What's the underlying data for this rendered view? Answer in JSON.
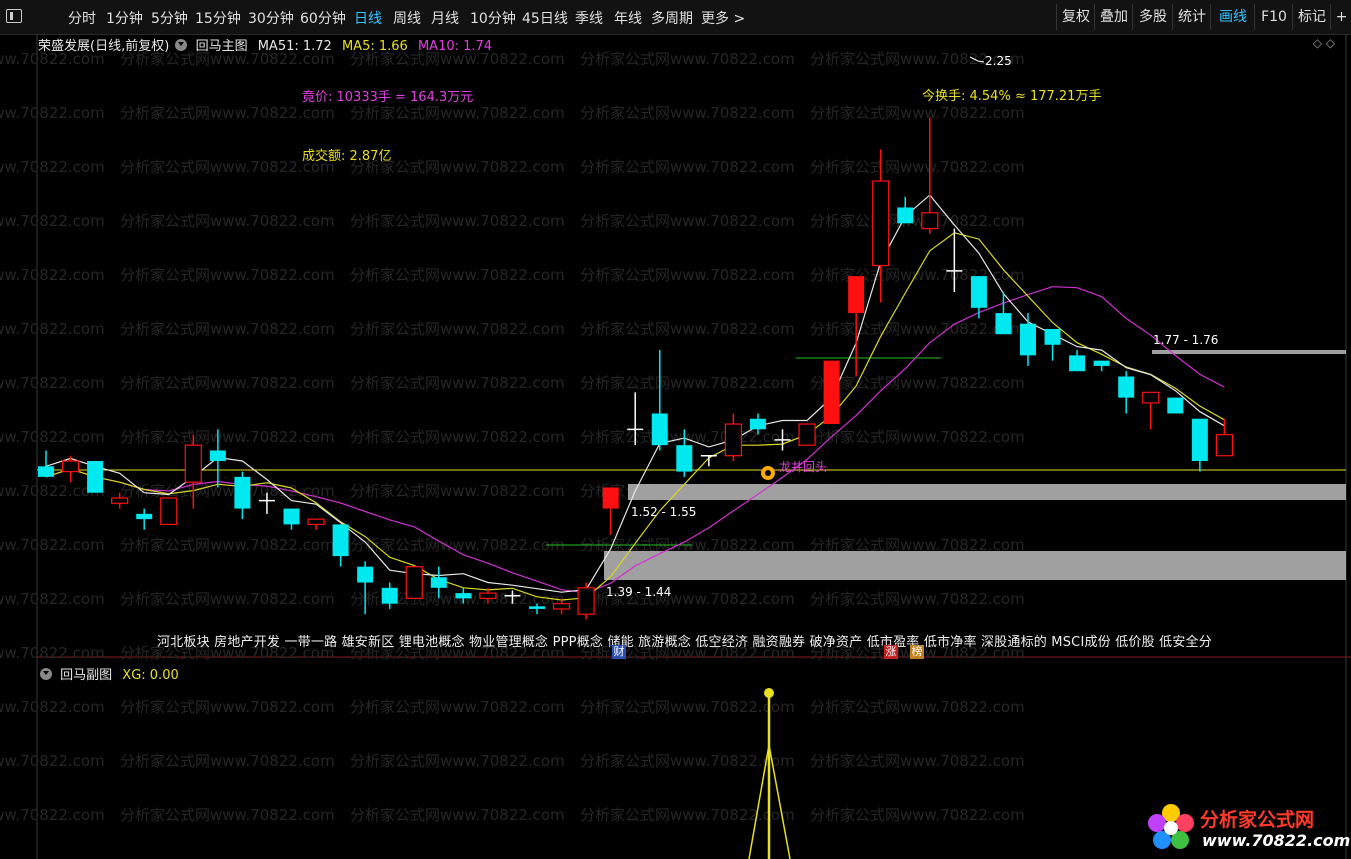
{
  "toolbar": {
    "periods": [
      "分时",
      "1分钟",
      "5分钟",
      "15分钟",
      "30分钟",
      "60分钟",
      "日线",
      "周线",
      "月线",
      "10分钟",
      "45日线",
      "季线",
      "年线",
      "多周期",
      "更多 >"
    ],
    "active_period": "日线",
    "right_buttons": [
      "复权",
      "叠加",
      "多股",
      "统计",
      "画线",
      "F10",
      "标记",
      "+"
    ],
    "active_right": "画线"
  },
  "main_chart": {
    "stock_name": "荣盛发展(日线,前复权)",
    "indicator": "回马主图",
    "ma51": "MA51: 1.72",
    "ma5": "MA5: 1.66",
    "ma10": "MA10: 1.74",
    "auction_label": "竟价: 10333手 = 164.3万元",
    "turnover_amount": "成交额: 2.87亿",
    "turnover_rate": "今换手: 4.54% ≈ 177.21万手",
    "high_marker": "2.25",
    "resist_label": "1.77 - 1.76",
    "support1_label": "1.52 - 1.55",
    "support2_label": "1.39 - 1.44",
    "signal_label": "龙井回头",
    "watermark": "分析家公式网www.70822.com"
  },
  "concepts": "河北板块 房地产开发 一带一路 雄安新区 锂电池概念 物业管理概念 PPP概念 储能 旅游概念 低空经济 融资融券 破净资产 低市盈率 低市净率 深股通标的 MSCI成份 低价股 低安全分",
  "badges": {
    "cai": "财",
    "zhang": "涨",
    "bang": "榜"
  },
  "sub_chart": {
    "indicator": "回马副图",
    "xg": "XG: 0.00"
  },
  "logo": {
    "name": "分析家公式网",
    "url": "www.70822.com"
  },
  "colors": {
    "up": "#ff1010",
    "down": "#00e8f0",
    "ma_white": "#e8e8e8",
    "ma_yellow": "#d8d820",
    "ma_magenta": "#d030d0",
    "label_magenta": "#e040e0",
    "label_yellow": "#e8e020",
    "gray_band": "#a0a0a0",
    "active": "#35c5ff"
  },
  "candles": [
    {
      "o": 1.59,
      "h": 1.62,
      "l": 1.57,
      "c": 1.57
    },
    {
      "o": 1.58,
      "h": 1.61,
      "l": 1.56,
      "c": 1.6
    },
    {
      "o": 1.6,
      "h": 1.6,
      "l": 1.54,
      "c": 1.54
    },
    {
      "o": 1.52,
      "h": 1.54,
      "l": 1.51,
      "c": 1.53
    },
    {
      "o": 1.5,
      "h": 1.51,
      "l": 1.47,
      "c": 1.49
    },
    {
      "o": 1.48,
      "h": 1.53,
      "l": 1.48,
      "c": 1.53
    },
    {
      "o": 1.56,
      "h": 1.65,
      "l": 1.51,
      "c": 1.63
    },
    {
      "o": 1.62,
      "h": 1.66,
      "l": 1.55,
      "c": 1.6
    },
    {
      "o": 1.57,
      "h": 1.58,
      "l": 1.49,
      "c": 1.51
    },
    {
      "o": 1.525,
      "h": 1.54,
      "l": 1.5,
      "c": 1.525
    },
    {
      "o": 1.51,
      "h": 1.51,
      "l": 1.47,
      "c": 1.48
    },
    {
      "o": 1.48,
      "h": 1.49,
      "l": 1.47,
      "c": 1.49
    },
    {
      "o": 1.48,
      "h": 1.48,
      "l": 1.4,
      "c": 1.42
    },
    {
      "o": 1.4,
      "h": 1.41,
      "l": 1.31,
      "c": 1.37
    },
    {
      "o": 1.36,
      "h": 1.37,
      "l": 1.32,
      "c": 1.33
    },
    {
      "o": 1.34,
      "h": 1.4,
      "l": 1.34,
      "c": 1.4
    },
    {
      "o": 1.38,
      "h": 1.4,
      "l": 1.34,
      "c": 1.36
    },
    {
      "o": 1.35,
      "h": 1.36,
      "l": 1.33,
      "c": 1.34
    },
    {
      "o": 1.34,
      "h": 1.36,
      "l": 1.33,
      "c": 1.35
    },
    {
      "o": 1.345,
      "h": 1.355,
      "l": 1.33,
      "c": 1.345
    },
    {
      "o": 1.325,
      "h": 1.33,
      "l": 1.31,
      "c": 1.32
    },
    {
      "o": 1.32,
      "h": 1.34,
      "l": 1.31,
      "c": 1.33
    },
    {
      "o": 1.31,
      "h": 1.37,
      "l": 1.3,
      "c": 1.36
    },
    {
      "o": 1.51,
      "h": 1.53,
      "l": 1.46,
      "c": 1.55
    },
    {
      "o": 1.66,
      "h": 1.73,
      "l": 1.63,
      "c": 1.66
    },
    {
      "o": 1.69,
      "h": 1.81,
      "l": 1.62,
      "c": 1.63
    },
    {
      "o": 1.63,
      "h": 1.66,
      "l": 1.57,
      "c": 1.58
    },
    {
      "o": 1.61,
      "h": 1.61,
      "l": 1.59,
      "c": 1.61
    },
    {
      "o": 1.61,
      "h": 1.69,
      "l": 1.6,
      "c": 1.67
    },
    {
      "o": 1.68,
      "h": 1.69,
      "l": 1.65,
      "c": 1.66
    },
    {
      "o": 1.64,
      "h": 1.66,
      "l": 1.62,
      "c": 1.64
    },
    {
      "o": 1.63,
      "h": 1.67,
      "l": 1.63,
      "c": 1.67
    },
    {
      "o": 1.67,
      "h": 1.79,
      "l": 1.67,
      "c": 1.79
    },
    {
      "o": 1.88,
      "h": 1.88,
      "l": 1.76,
      "c": 1.95
    },
    {
      "o": 1.97,
      "h": 2.19,
      "l": 1.9,
      "c": 2.13
    },
    {
      "o": 2.08,
      "h": 2.1,
      "l": 2.05,
      "c": 2.05
    },
    {
      "o": 2.04,
      "h": 2.25,
      "l": 2.03,
      "c": 2.07
    },
    {
      "o": 1.96,
      "h": 2.04,
      "l": 1.92,
      "c": 1.96
    },
    {
      "o": 1.95,
      "h": 1.95,
      "l": 1.87,
      "c": 1.89
    },
    {
      "o": 1.88,
      "h": 1.92,
      "l": 1.84,
      "c": 1.84
    },
    {
      "o": 1.86,
      "h": 1.88,
      "l": 1.78,
      "c": 1.8
    },
    {
      "o": 1.85,
      "h": 1.85,
      "l": 1.79,
      "c": 1.82
    },
    {
      "o": 1.8,
      "h": 1.81,
      "l": 1.77,
      "c": 1.77
    },
    {
      "o": 1.79,
      "h": 1.79,
      "l": 1.77,
      "c": 1.78
    },
    {
      "o": 1.76,
      "h": 1.77,
      "l": 1.69,
      "c": 1.72
    },
    {
      "o": 1.71,
      "h": 1.72,
      "l": 1.66,
      "c": 1.73
    },
    {
      "o": 1.72,
      "h": 1.72,
      "l": 1.69,
      "c": 1.69
    },
    {
      "o": 1.68,
      "h": 1.68,
      "l": 1.58,
      "c": 1.6
    },
    {
      "o": 1.61,
      "h": 1.68,
      "l": 1.61,
      "c": 1.65
    }
  ]
}
